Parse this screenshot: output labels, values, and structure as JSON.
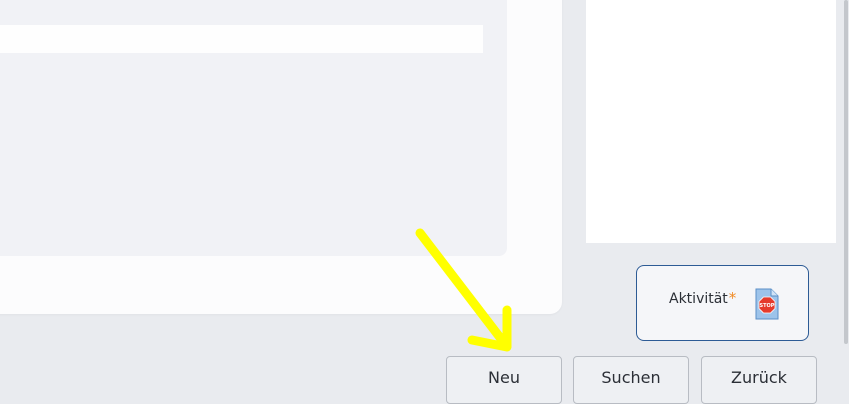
{
  "form": {
    "text_field_value": ""
  },
  "activity": {
    "label": "Aktivität",
    "required_marker": "*",
    "icon": "stop-document-icon",
    "border_color": "#2d5b95",
    "required_color": "#f08a24"
  },
  "buttons": {
    "new_label": "Neu",
    "search_label": "Suchen",
    "back_label": "Zurück"
  },
  "annotation": {
    "type": "arrow",
    "color": "#ffff00",
    "points_to": "new-button"
  }
}
